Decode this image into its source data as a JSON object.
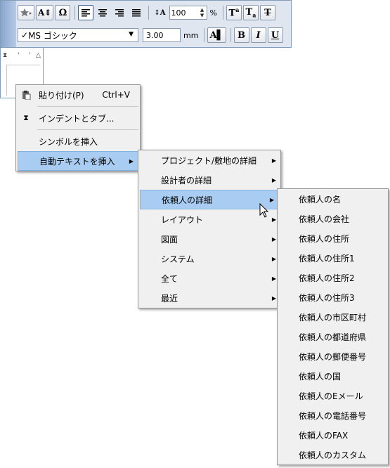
{
  "toolbar": {
    "row1": {
      "leading_value": "100",
      "leading_unit": "%"
    },
    "row2": {
      "font_name": "MS ゴシック",
      "font_size": "3.00",
      "font_size_unit": "mm"
    }
  },
  "context_menu": {
    "items": [
      {
        "label": "貼り付け(P)",
        "shortcut": "Ctrl+V"
      },
      {
        "label": "インデントとタブ..."
      },
      {
        "label": "シンボルを挿入"
      },
      {
        "label": "自動テキストを挿入"
      }
    ]
  },
  "submenu_autotext": {
    "items": [
      {
        "label": "プロジェクト/敷地の詳細"
      },
      {
        "label": "設計者の詳細"
      },
      {
        "label": "依頼人の詳細"
      },
      {
        "label": "レイアウト"
      },
      {
        "label": "図面"
      },
      {
        "label": "システム"
      },
      {
        "label": "全て"
      },
      {
        "label": "最近"
      }
    ]
  },
  "submenu_client": {
    "items": [
      {
        "label": "依頼人の名"
      },
      {
        "label": "依頼人の会社"
      },
      {
        "label": "依頼人の住所"
      },
      {
        "label": "依頼人の住所1"
      },
      {
        "label": "依頼人の住所2"
      },
      {
        "label": "依頼人の住所3"
      },
      {
        "label": "依頼人の市区町村"
      },
      {
        "label": "依頼人の都道府県"
      },
      {
        "label": "依頼人の郵便番号"
      },
      {
        "label": "依頼人の国"
      },
      {
        "label": "依頼人のEメール"
      },
      {
        "label": "依頼人の電話番号"
      },
      {
        "label": "依頼人のFAX"
      },
      {
        "label": "依頼人のカスタム"
      }
    ]
  },
  "colors": {
    "highlight": "#a9cdf2",
    "menu_bg": "#f0f0f0",
    "toolbar_bg": "#dfe6ef"
  }
}
